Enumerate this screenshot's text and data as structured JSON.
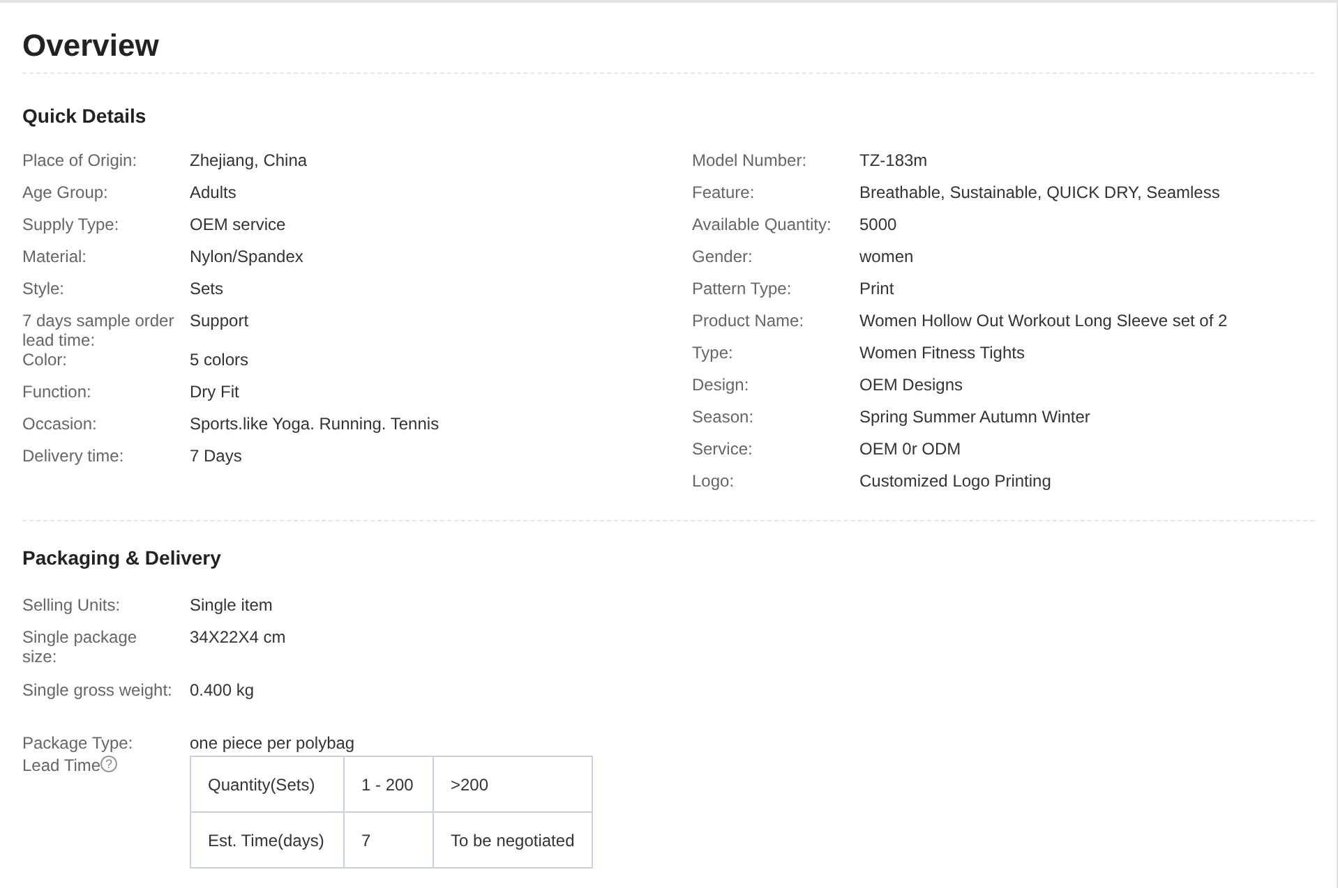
{
  "title": "Overview",
  "quick_details": {
    "heading": "Quick Details",
    "left": [
      {
        "label": "Place of Origin:",
        "value": "Zhejiang, China"
      },
      {
        "label": "Age Group:",
        "value": "Adults"
      },
      {
        "label": "Supply Type:",
        "value": "OEM service"
      },
      {
        "label": "Material:",
        "value": "Nylon/Spandex"
      },
      {
        "label": "Style:",
        "value": "Sets"
      },
      {
        "label": "7 days sample order lead time:",
        "value": "Support"
      },
      {
        "label": "Color:",
        "value": "5 colors"
      },
      {
        "label": "Function:",
        "value": "Dry Fit"
      },
      {
        "label": "Occasion:",
        "value": "Sports.like Yoga. Running. Tennis"
      },
      {
        "label": "Delivery time:",
        "value": "7 Days"
      }
    ],
    "right": [
      {
        "label": "Model Number:",
        "value": "TZ-183m"
      },
      {
        "label": "Feature:",
        "value": "Breathable, Sustainable, QUICK DRY, Seamless"
      },
      {
        "label": "Available Quantity:",
        "value": "5000"
      },
      {
        "label": "Gender:",
        "value": "women"
      },
      {
        "label": "Pattern Type:",
        "value": "Print"
      },
      {
        "label": "Product Name:",
        "value": "Women Hollow Out Workout Long Sleeve set of 2"
      },
      {
        "label": "Type:",
        "value": "Women Fitness Tights"
      },
      {
        "label": "Design:",
        "value": "OEM Designs"
      },
      {
        "label": "Season:",
        "value": "Spring Summer Autumn Winter"
      },
      {
        "label": "Service:",
        "value": "OEM 0r ODM"
      },
      {
        "label": "Logo:",
        "value": "Customized Logo Printing"
      }
    ]
  },
  "packaging": {
    "heading": "Packaging & Delivery",
    "rows": [
      {
        "label": "Selling Units:",
        "value": "Single item"
      },
      {
        "label": "Single package size:",
        "value": "34X22X4 cm"
      },
      {
        "label": "Single gross weight:",
        "value": "0.400 kg"
      },
      {
        "label": "Package Type:",
        "value": "one piece per polybag"
      }
    ],
    "lead_time": {
      "label": "Lead Time",
      "help_icon": "?",
      "table": [
        [
          "Quantity(Sets)",
          "1 - 200",
          ">200"
        ],
        [
          "Est. Time(days)",
          "7",
          "To be negotiated"
        ]
      ]
    }
  }
}
